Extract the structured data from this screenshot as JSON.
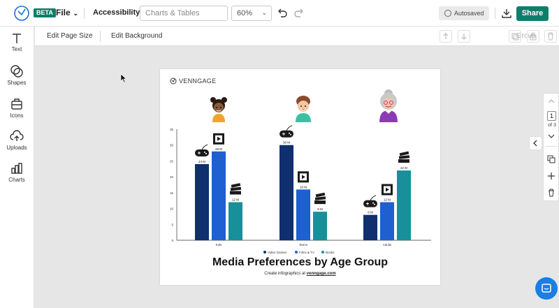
{
  "topbar": {
    "beta_badge": "BETA",
    "file_menu": "File",
    "accessibility": "Accessibility",
    "doc_title_placeholder": "Charts & Tables",
    "zoom": "60%",
    "autosaved": "Autosaved",
    "share": "Share"
  },
  "sidebar": {
    "items": [
      {
        "label": "Text",
        "icon": "text-icon"
      },
      {
        "label": "Shapes",
        "icon": "shapes-icon"
      },
      {
        "label": "Icons",
        "icon": "icons-icon"
      },
      {
        "label": "Uploads",
        "icon": "upload-icon"
      },
      {
        "label": "Charts",
        "icon": "charts-icon"
      }
    ]
  },
  "context_bar": {
    "edit_page_size": "Edit Page Size",
    "edit_background": "Edit Background",
    "group": "Group"
  },
  "canvas": {
    "brand": "VENNGAGE",
    "title": "Media Preferences by Age Group",
    "footer_prefix": "Create infographics at ",
    "footer_link": "venngage.com"
  },
  "pager": {
    "current": "1",
    "total_label": "of 3"
  },
  "colors": {
    "accent": "#0e7e6a",
    "video_games": "#0f2f6e",
    "films_tv": "#1f5fd0",
    "books": "#17909a"
  },
  "chart_data": {
    "type": "bar",
    "title": "Media Preferences by Age Group",
    "categories": [
      "Kids",
      "Teens",
      "Adults"
    ],
    "series": [
      {
        "name": "Video Games",
        "values": [
          24,
          30,
          8
        ],
        "labels": [
          "24 M",
          "30 M",
          "8 M"
        ]
      },
      {
        "name": "Films & TV",
        "values": [
          28,
          16,
          12
        ],
        "labels": [
          "28 M",
          "16 M",
          "12 M"
        ]
      },
      {
        "name": "Books",
        "values": [
          12,
          9,
          22
        ],
        "labels": [
          "12 M",
          "9 M",
          "22 M"
        ]
      }
    ],
    "yticks": [
      "0",
      "5",
      "10",
      "15",
      "20",
      "25",
      "30",
      "35"
    ],
    "ylim": [
      0,
      35
    ],
    "legend": "bottom",
    "grid": false
  }
}
